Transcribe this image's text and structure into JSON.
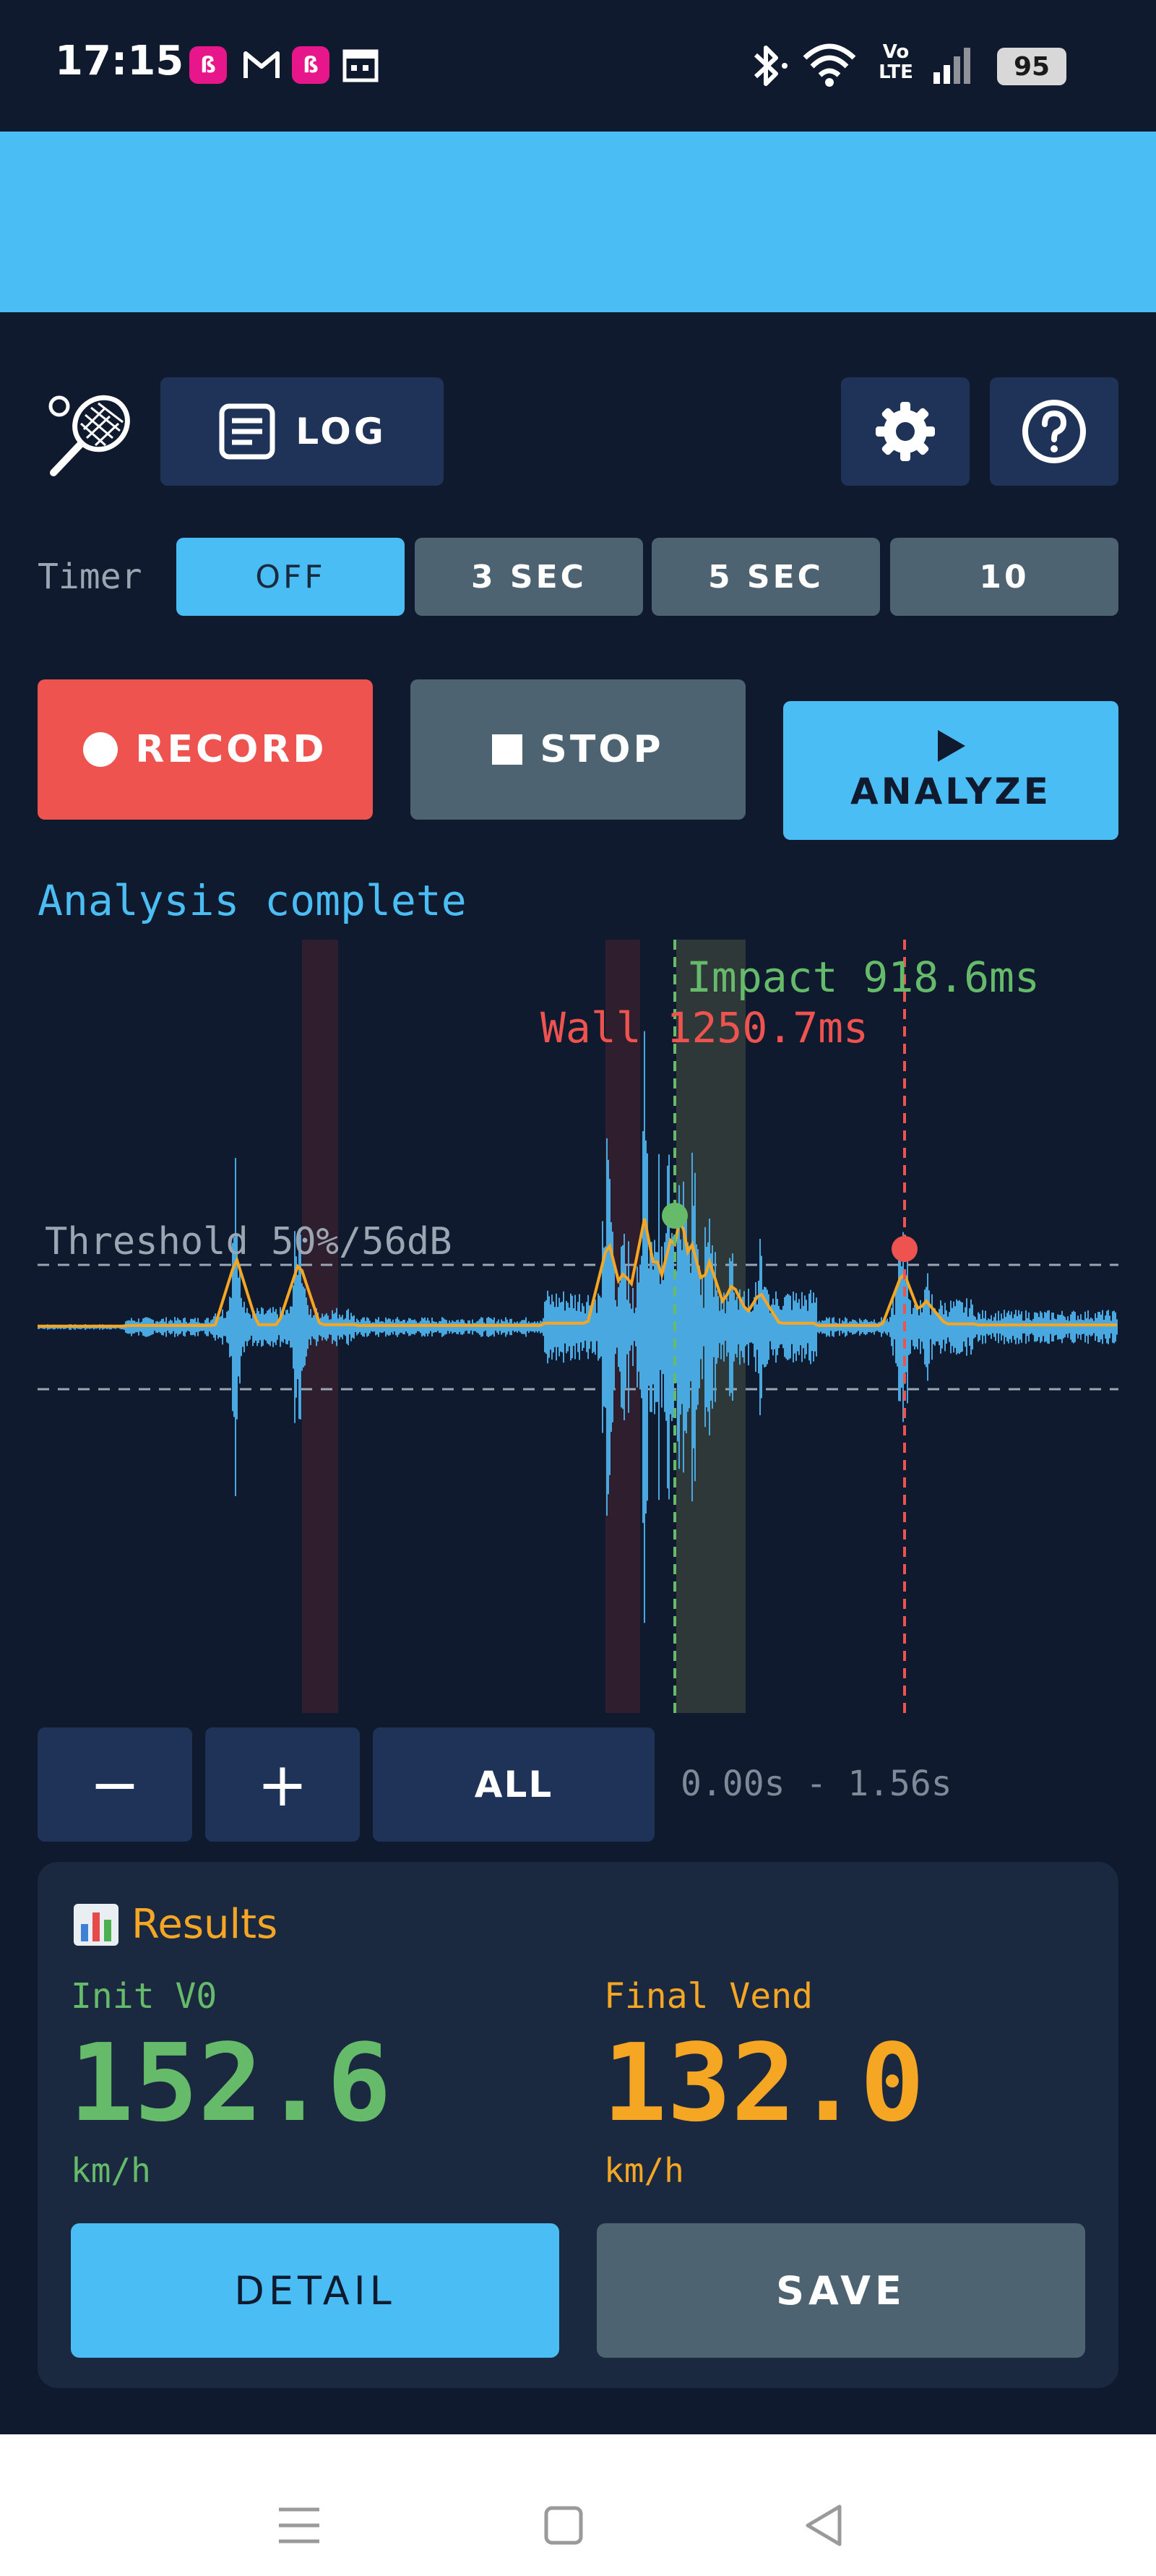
{
  "status_bar": {
    "time": "17:15",
    "battery": "95",
    "network_label": "Vo LTE",
    "icons": [
      "notification-app-icon",
      "gmail-icon",
      "notification-app-icon",
      "calendar-icon",
      "bluetooth-icon",
      "wifi-icon",
      "volte-icon",
      "signal-icon",
      "battery-icon"
    ]
  },
  "toolbar": {
    "log_label": "LOG",
    "settings_icon": "gear-icon",
    "help_icon": "question-icon",
    "logo_icon": "tennis-racket-icon"
  },
  "timer": {
    "label": "Timer",
    "options": [
      "OFF",
      "3 SEC",
      "5 SEC",
      "10"
    ],
    "selected": "OFF"
  },
  "controls": {
    "record_label": "RECORD",
    "stop_label": "STOP",
    "analyze_label": "ANALYZE"
  },
  "status_text": "Analysis complete",
  "chart": {
    "impact_label": "Impact 918.6ms",
    "wall_label": "Wall 1250.7ms",
    "threshold_label": "Threshold 50%/56dB",
    "colors": {
      "waveform": "#4aa8e0",
      "envelope": "#f5a623",
      "impact": "#66bb6a",
      "wall": "#ef5350",
      "threshold": "#9aa6b2"
    }
  },
  "zoom": {
    "minus_label": "−",
    "plus_label": "+",
    "all_label": "ALL",
    "range_text": "0.00s - 1.56s"
  },
  "results": {
    "title": "Results",
    "title_icon": "bar-chart-icon",
    "init_label": "Init V0",
    "init_value": "152.6",
    "init_unit": "km/h",
    "final_label": "Final Vend",
    "final_value": "132.0",
    "final_unit": "km/h",
    "detail_label": "DETAIL",
    "save_label": "SAVE"
  },
  "nav": {
    "icons": [
      "menu-icon",
      "home-icon",
      "back-icon"
    ]
  }
}
